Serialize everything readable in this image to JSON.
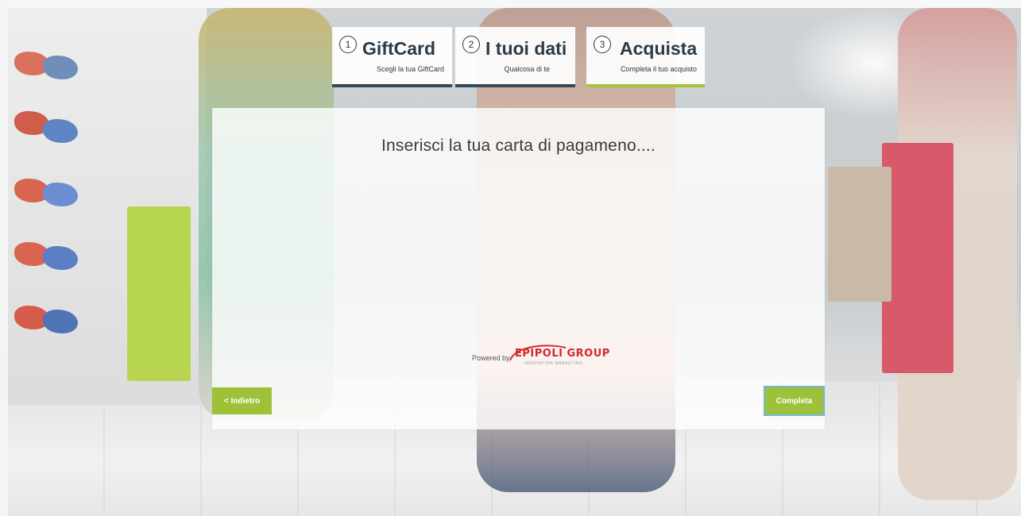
{
  "steps": [
    {
      "number": "1",
      "title": "GiftCard",
      "subtitle": "Scegli la tua GiftCard",
      "active": false
    },
    {
      "number": "2",
      "title": "I tuoi dati",
      "subtitle": "Qualcosa di te",
      "active": false
    },
    {
      "number": "3",
      "title": "Acquista",
      "subtitle": "Completa il tuo acquisto",
      "active": true
    }
  ],
  "panel": {
    "title": "Inserisci la tua carta di pagameno...."
  },
  "powered_by": {
    "label": "Powered by",
    "logo_text": "EPIPOLI GROUP",
    "logo_tagline": "INNOVATION MARKETING"
  },
  "buttons": {
    "back_label": "< Indietro",
    "complete_label": "Completa"
  },
  "colors": {
    "accent": "#9fc13a",
    "step_border": "#35495a",
    "active_step_border": "#a5c43a",
    "logo_red": "#d3282b"
  }
}
